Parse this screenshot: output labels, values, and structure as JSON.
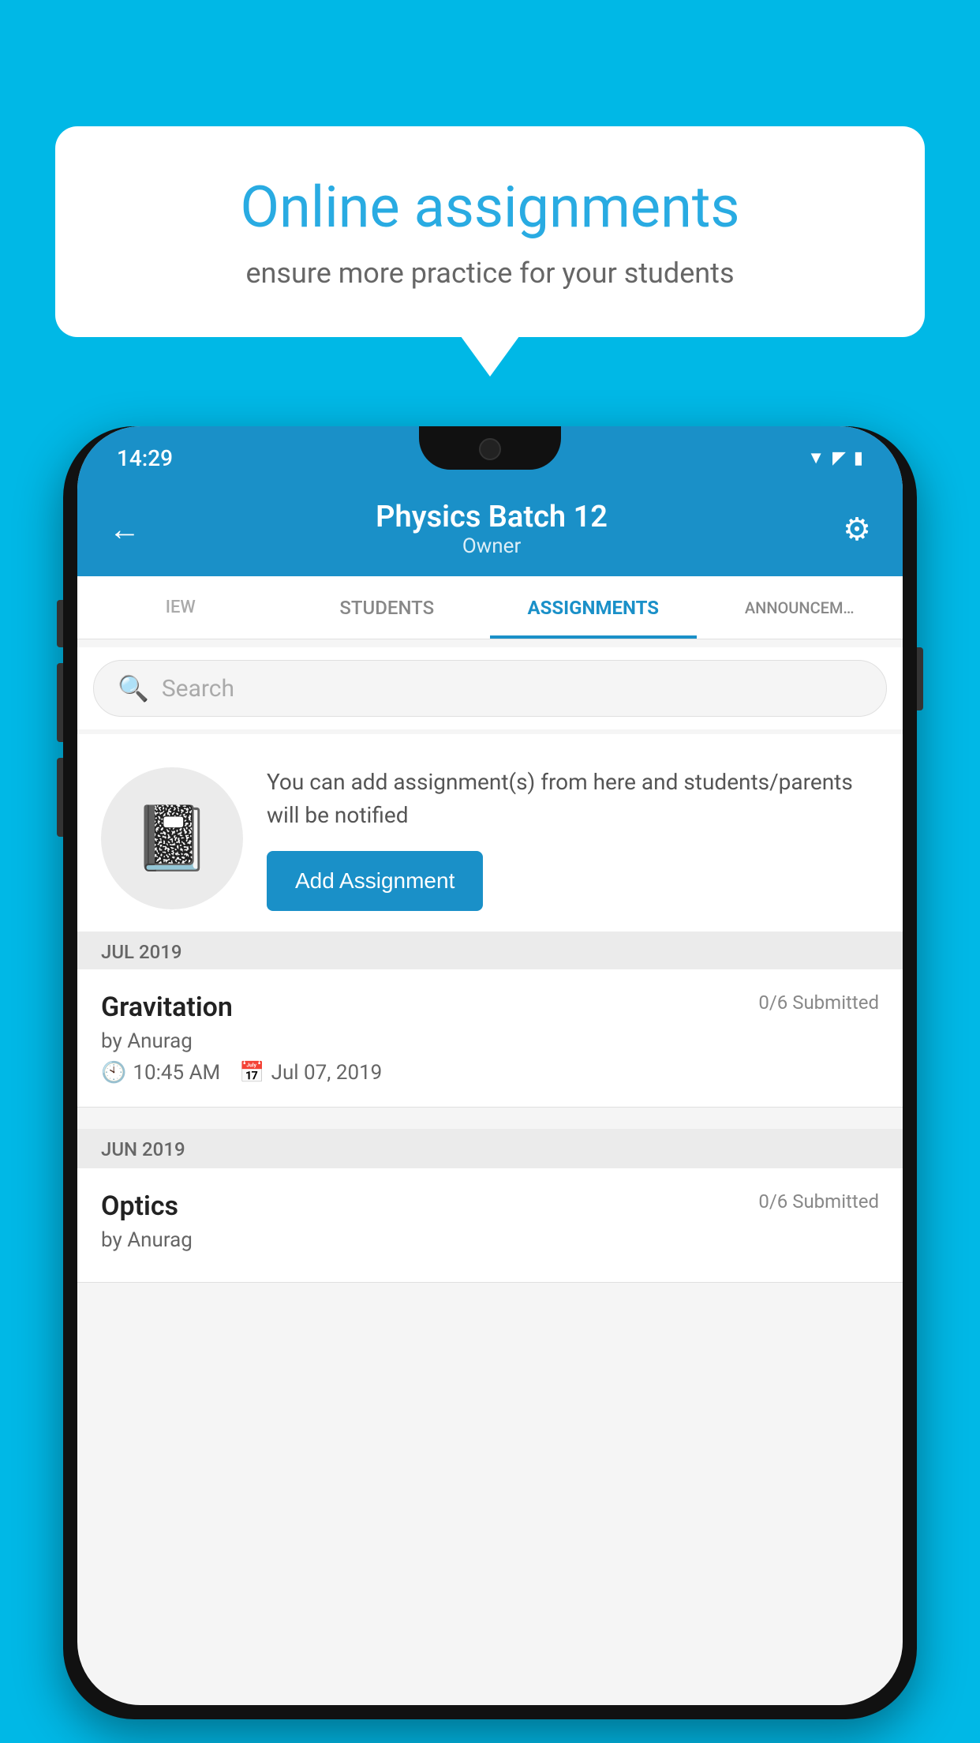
{
  "background_color": "#00B8E6",
  "speech_bubble": {
    "title": "Online assignments",
    "subtitle": "ensure more practice for your students"
  },
  "status_bar": {
    "time": "14:29",
    "icons": [
      "wifi",
      "signal",
      "battery"
    ]
  },
  "app_bar": {
    "title": "Physics Batch 12",
    "subtitle": "Owner",
    "back_label": "←",
    "settings_label": "⚙"
  },
  "tabs": [
    {
      "label": "IEW",
      "active": false
    },
    {
      "label": "STUDENTS",
      "active": false
    },
    {
      "label": "ASSIGNMENTS",
      "active": true
    },
    {
      "label": "ANNOUNCEM…",
      "active": false
    }
  ],
  "search": {
    "placeholder": "Search"
  },
  "empty_state": {
    "description": "You can add assignment(s) from here and students/parents will be notified",
    "button_label": "Add Assignment"
  },
  "sections": [
    {
      "month_label": "JUL 2019",
      "assignments": [
        {
          "name": "Gravitation",
          "submitted": "0/6 Submitted",
          "by": "by Anurag",
          "time": "10:45 AM",
          "date": "Jul 07, 2019"
        }
      ]
    },
    {
      "month_label": "JUN 2019",
      "assignments": [
        {
          "name": "Optics",
          "submitted": "0/6 Submitted",
          "by": "by Anurag",
          "time": "",
          "date": ""
        }
      ]
    }
  ]
}
